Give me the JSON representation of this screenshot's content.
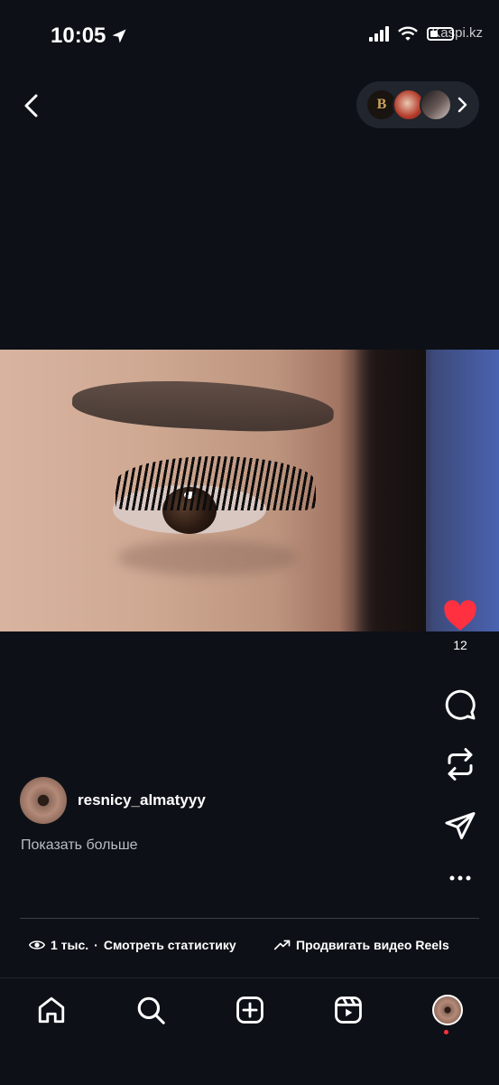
{
  "status": {
    "time": "10:05",
    "watermark": "Kaspi.kz"
  },
  "post": {
    "likes": "12",
    "author": "resnicy_almatyyy",
    "show_more": "Показать больше"
  },
  "footer": {
    "views": "1 тыс.",
    "separator": "·",
    "stats_link": "Смотреть статистику",
    "promote": "Продвигать видео Reels"
  },
  "colors": {
    "like": "#ff3040",
    "background": "#0d1117"
  },
  "icons": {
    "back": "chevron-left-icon",
    "like": "heart-icon",
    "comment": "comment-icon",
    "repost": "repost-icon",
    "share": "send-icon",
    "more": "more-icon",
    "home": "home-icon",
    "search": "search-icon",
    "create": "create-icon",
    "reels": "reels-icon"
  }
}
